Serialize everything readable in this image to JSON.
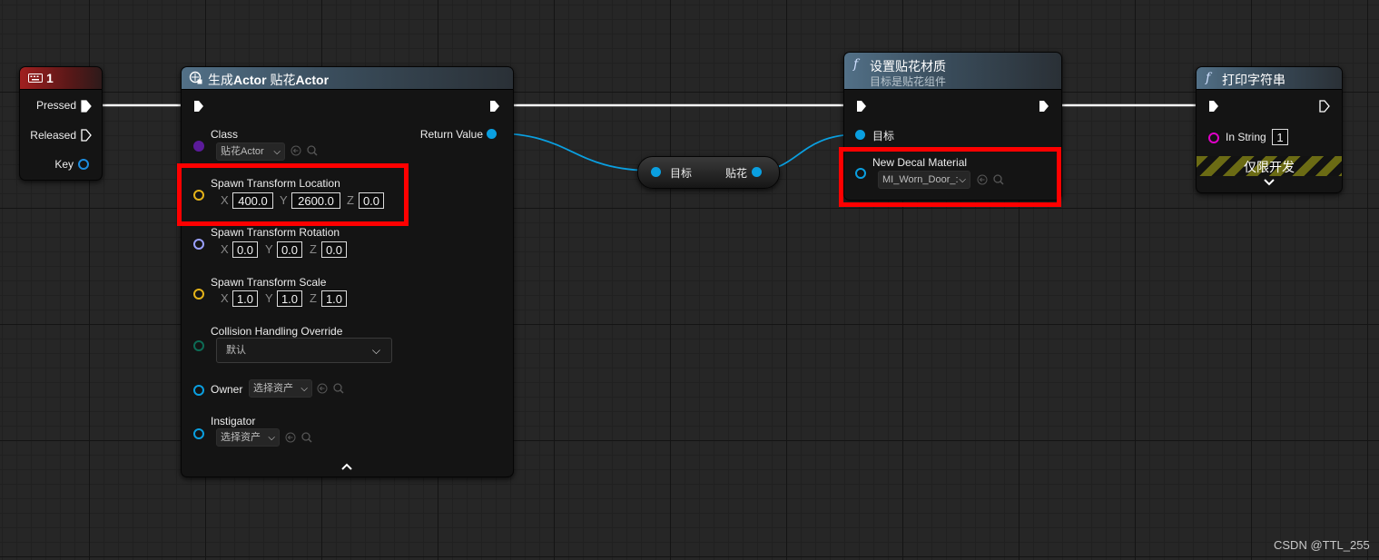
{
  "graph": {
    "wire_color_exec": "#ffffff",
    "wire_color_object": "#0a9fe0",
    "highlight_color": "#ff0000"
  },
  "input_node": {
    "title": "1",
    "icon": "keyboard-icon",
    "pins": {
      "pressed": "Pressed",
      "released": "Released",
      "key": "Key"
    }
  },
  "spawn_node": {
    "title_prefix": "生成",
    "title_bold": "Actor",
    "title_mid": " 贴花",
    "title_bold2": "Actor",
    "icon": "spawn-actor-icon",
    "class_label": "Class",
    "class_value": "贴花Actor",
    "return_value": "Return Value",
    "location_label": "Spawn Transform Location",
    "location": {
      "x_label": "X",
      "x": "400.0",
      "y_label": "Y",
      "y": "2600.0",
      "z_label": "Z",
      "z": "0.0"
    },
    "rotation_label": "Spawn Transform Rotation",
    "rotation": {
      "x_label": "X",
      "x": "0.0",
      "y_label": "Y",
      "y": "0.0",
      "z_label": "Z",
      "z": "0.0"
    },
    "scale_label": "Spawn Transform Scale",
    "scale": {
      "x_label": "X",
      "x": "1.0",
      "y_label": "Y",
      "y": "1.0",
      "z_label": "Z",
      "z": "1.0"
    },
    "collision_label": "Collision Handling Override",
    "collision_value": "默认",
    "owner_label": "Owner",
    "owner_value": "选择资产",
    "instigator_label": "Instigator",
    "instigator_value": "选择资产"
  },
  "cast_node": {
    "in_label": "目标",
    "out_label": "贴花"
  },
  "set_decal_node": {
    "title": "设置贴花材质",
    "subtitle": "目标是贴花组件",
    "function_icon": "f",
    "target_label": "目标",
    "material_label": "New Decal Material",
    "material_value": "MI_Worn_Door_:"
  },
  "print_node": {
    "title": "打印字符串",
    "function_icon": "f",
    "in_string_label": "In String",
    "in_string_value": "1",
    "dev_only_label": "仅限开发"
  },
  "watermark": "CSDN @TTL_255"
}
